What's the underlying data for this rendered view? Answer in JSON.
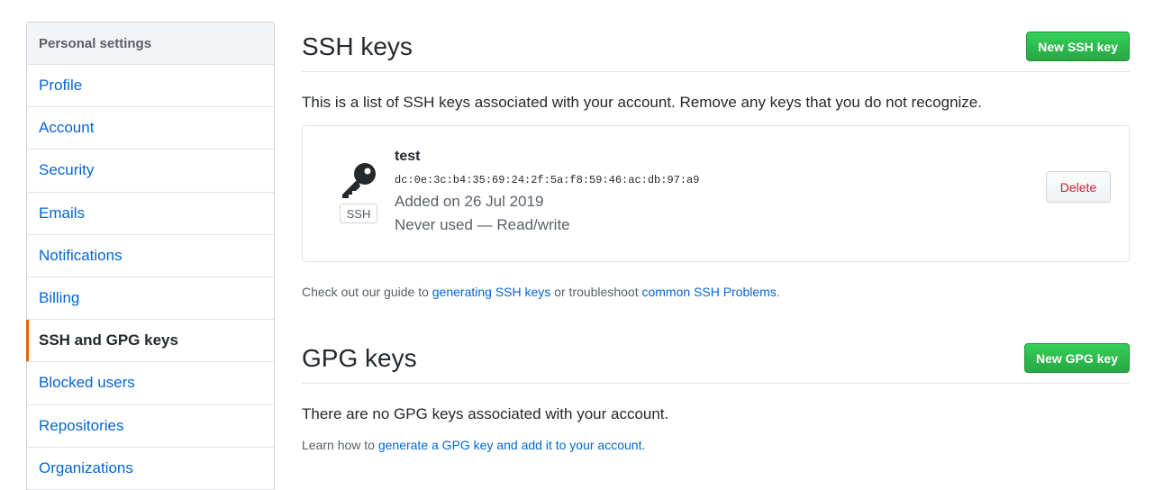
{
  "sidebar": {
    "header": "Personal settings",
    "items": [
      {
        "label": "Profile"
      },
      {
        "label": "Account"
      },
      {
        "label": "Security"
      },
      {
        "label": "Emails"
      },
      {
        "label": "Notifications"
      },
      {
        "label": "Billing"
      },
      {
        "label": "SSH and GPG keys",
        "selected": true
      },
      {
        "label": "Blocked users"
      },
      {
        "label": "Repositories"
      },
      {
        "label": "Organizations"
      }
    ]
  },
  "ssh": {
    "title": "SSH keys",
    "new_button": "New SSH key",
    "intro": "This is a list of SSH keys associated with your account. Remove any keys that you do not recognize.",
    "key": {
      "icon": "key-icon",
      "type_badge": "SSH",
      "title": "test",
      "fingerprint": "dc:0e:3c:b4:35:69:24:2f:5a:f8:59:46:ac:db:97:a9",
      "added": "Added on 26 Jul 2019",
      "usage": "Never used — Read/write",
      "delete_label": "Delete"
    },
    "guide": {
      "prefix": "Check out our guide to ",
      "link1": "generating SSH keys",
      "middle": " or troubleshoot ",
      "link2": "common SSH Problems",
      "suffix": "."
    }
  },
  "gpg": {
    "title": "GPG keys",
    "new_button": "New GPG key",
    "empty": "There are no GPG keys associated with your account.",
    "learn": {
      "prefix": "Learn how to ",
      "link": "generate a GPG key and add it to your account",
      "suffix": "."
    }
  },
  "colors": {
    "link": "#0366d6",
    "primary_button": "#28a745",
    "danger": "#cb2431",
    "selected_indicator": "#e36209"
  }
}
